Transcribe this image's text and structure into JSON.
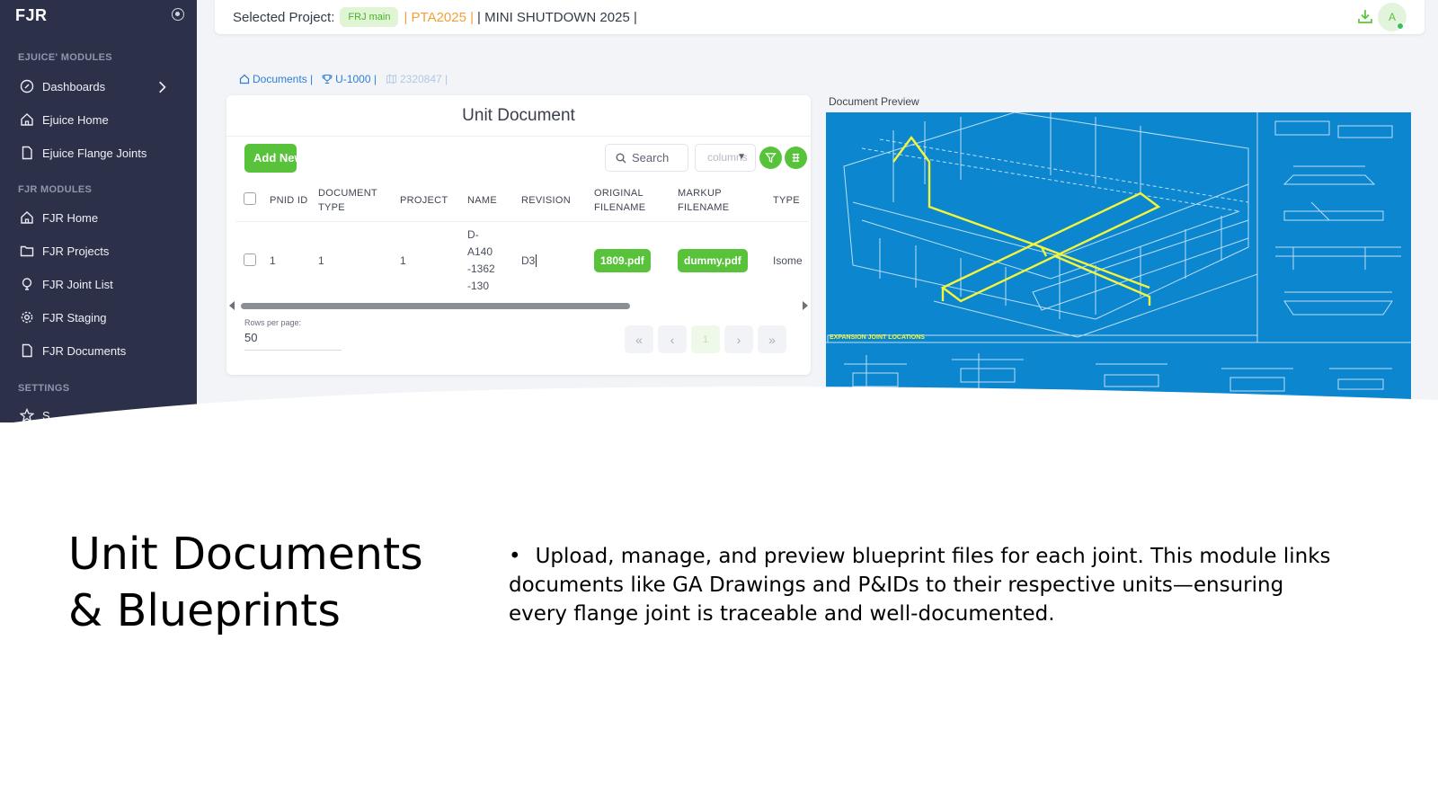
{
  "sidebar": {
    "brand": "FJR",
    "section_ejuice": "EJUICE' MODULES",
    "section_fjr": "FJR MODULES",
    "section_settings": "SETTINGS",
    "ejuice_items": [
      {
        "label": "Dashboards",
        "icon": "dashboard-icon"
      },
      {
        "label": "Ejuice Home",
        "icon": "home-icon"
      },
      {
        "label": "Ejuice Flange Joints",
        "icon": "file-icon"
      }
    ],
    "fjr_items": [
      {
        "label": "FJR Home",
        "icon": "home-icon"
      },
      {
        "label": "FJR Projects",
        "icon": "folder-icon"
      },
      {
        "label": "FJR Joint List",
        "icon": "bulb-icon"
      },
      {
        "label": "FJR Staging",
        "icon": "gear-icon"
      },
      {
        "label": "FJR Documents",
        "icon": "file-icon"
      }
    ],
    "settings_items": [
      {
        "label": "S",
        "icon": "star-icon"
      }
    ]
  },
  "header": {
    "label": "Selected Project:",
    "badge": "FRJ main",
    "project_code": "| PTA2025 |",
    "project_name": "| MINI SHUTDOWN 2025 |",
    "avatar": "A",
    "accent": "#58c33a"
  },
  "breadcrumb": {
    "items": [
      "Documents |",
      "U-1000 |",
      "2320847 |"
    ]
  },
  "card": {
    "title": "Unit Document",
    "add_button": "Add New",
    "search_label": "Search",
    "columns_placeholder": "columns",
    "headers": {
      "pnid": "PNID ID",
      "document_type": "DOCUMENT TYPE",
      "project": "PROJECT",
      "name": "NAME",
      "revision": "REVISION",
      "original_filename": "ORIGINAL FILENAME",
      "markup_filename": "MARKUP FILENAME",
      "type": "TYPE"
    },
    "rows": [
      {
        "pnid": "1",
        "document_type": "1",
        "project": "1",
        "name_lines": [
          "D-",
          "A140",
          "-1362",
          "-130"
        ],
        "revision": "D3",
        "original_filename": "1809.pdf",
        "markup_filename": "dummy.pdf",
        "type": "Isome"
      }
    ],
    "rows_per_page_label": "Rows per page:",
    "rows_per_page_value": "50",
    "pager": {
      "first": "«",
      "prev": "‹",
      "current": "1",
      "next": "›",
      "last": "»"
    }
  },
  "preview": {
    "label": "Document Preview",
    "blueprint_caption": "EXPANSION JOINT LOCATIONS",
    "blueprint_bg": "#0b86cf",
    "highlight": "#f5f53a"
  },
  "slide": {
    "title_line1": "Unit Documents",
    "title_line2": "& Blueprints",
    "bullet": "•",
    "body": "Upload, manage, and preview blueprint files for each joint. This module links documents like GA Drawings and P&IDs to their respective units—ensuring every flange joint is traceable and well-documented."
  }
}
